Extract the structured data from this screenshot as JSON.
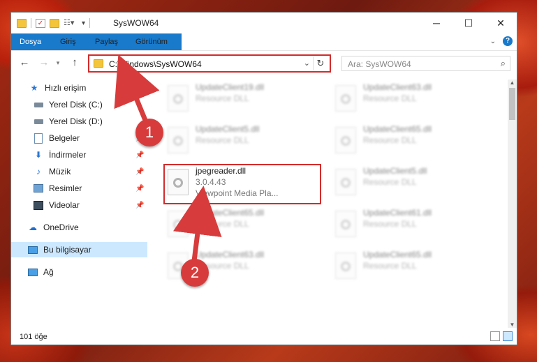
{
  "window": {
    "title": "SysWOW64"
  },
  "window_controls": {
    "minimize": "─",
    "maximize": "☐",
    "close": "✕"
  },
  "ribbon": {
    "tabs": [
      "Dosya",
      "Giriş",
      "Paylaş",
      "Görünüm"
    ],
    "help": "?"
  },
  "address": {
    "path": "C:\\Windows\\SysWOW64"
  },
  "search": {
    "placeholder": "Ara: SysWOW64"
  },
  "sidebar": {
    "items": [
      {
        "label": "Hızlı erişim",
        "icon": "star-icon"
      },
      {
        "label": "Yerel Disk (C:)",
        "icon": "drive-icon"
      },
      {
        "label": "Yerel Disk (D:)",
        "icon": "drive-icon"
      },
      {
        "label": "Belgeler",
        "icon": "documents-icon",
        "pinned": true
      },
      {
        "label": "İndirmeler",
        "icon": "download-icon",
        "pinned": true
      },
      {
        "label": "Müzik",
        "icon": "music-icon",
        "pinned": true
      },
      {
        "label": "Resimler",
        "icon": "pictures-icon",
        "pinned": true
      },
      {
        "label": "Videolar",
        "icon": "videos-icon",
        "pinned": true
      },
      {
        "label": "OneDrive",
        "icon": "cloud-icon"
      },
      {
        "label": "Bu bilgisayar",
        "icon": "computer-icon",
        "selected": true
      },
      {
        "label": "Ağ",
        "icon": "network-icon"
      }
    ]
  },
  "files": {
    "left": [
      {
        "name": "UpdateClient19.dll",
        "type": "Resource DLL"
      },
      {
        "name": "UpdateClient5.dll",
        "type": "Resource DLL"
      },
      {
        "name": "jpegreader.dll",
        "version": "3.0.4.43",
        "desc": "Viewpoint Media Pla...",
        "highlighted": true
      },
      {
        "name": "UpdateClient65.dll",
        "type": "Resource DLL"
      },
      {
        "name": "UpdateClient63.dll",
        "type": "Resource DLL"
      }
    ],
    "right": [
      {
        "name": "UpdateClient63.dll",
        "type": "Resource DLL"
      },
      {
        "name": "UpdateClient65.dll",
        "type": "Resource DLL"
      },
      {
        "name": "UpdateClient5.dll",
        "type": "Resource DLL"
      },
      {
        "name": "UpdateClient61.dll",
        "type": "Resource DLL"
      },
      {
        "name": "UpdateClient65.dll",
        "type": "Resource DLL"
      }
    ]
  },
  "status": {
    "count": "101 öğe"
  },
  "annotations": {
    "step1": "1",
    "step2": "2",
    "color": "#d83b3b"
  }
}
